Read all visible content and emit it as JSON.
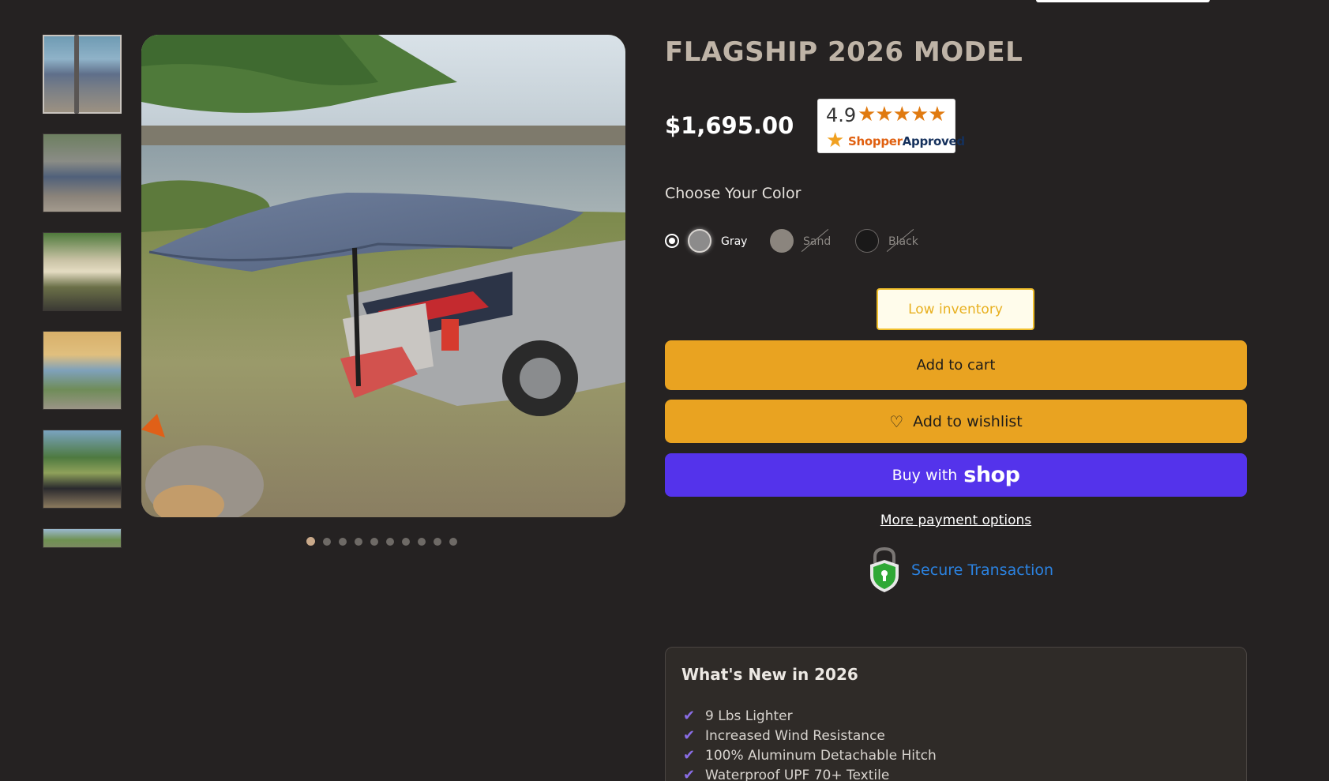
{
  "product": {
    "title": "FLAGSHIP 2026 MODEL",
    "price": "$1,695.00"
  },
  "rating": {
    "value": "4.9",
    "stars": "★★★★★",
    "brand_part1": "Shopper",
    "brand_part2": "Approved"
  },
  "gallery": {
    "thumbnail_count": 6,
    "slide_count": 10,
    "active_slide": 1
  },
  "color": {
    "label": "Choose Your Color",
    "selected": "Gray",
    "options": [
      {
        "name": "Gray",
        "hex": "#8c8b8b",
        "available": true
      },
      {
        "name": "Sand",
        "hex": "#8b857e",
        "available": false
      },
      {
        "name": "Black",
        "hex": "#1a1919",
        "available": false
      }
    ]
  },
  "inventory": {
    "status": "Low inventory"
  },
  "actions": {
    "add_to_cart": "Add to cart",
    "add_to_wishlist": "Add to wishlist",
    "buy_with": "Buy with",
    "shop_brand": "shop",
    "more_payment_options": "More payment options"
  },
  "security": {
    "label": "Secure Transaction"
  },
  "whats_new": {
    "title": "What's New in 2026",
    "items": [
      "9 Lbs Lighter",
      "Increased Wind Resistance",
      "100% Aluminum Detachable Hitch",
      "Waterproof UPF 70+ Textile"
    ]
  },
  "colors": {
    "background": "#252222",
    "accent_button": "#e9a321",
    "shop_button": "#5433eb",
    "title": "#bfb4a7",
    "secure_link": "#2b82e0",
    "rating_stars": "#e07a10"
  },
  "icons": [
    "heart-icon",
    "shield-lock-icon",
    "check-icon",
    "star-icon"
  ]
}
